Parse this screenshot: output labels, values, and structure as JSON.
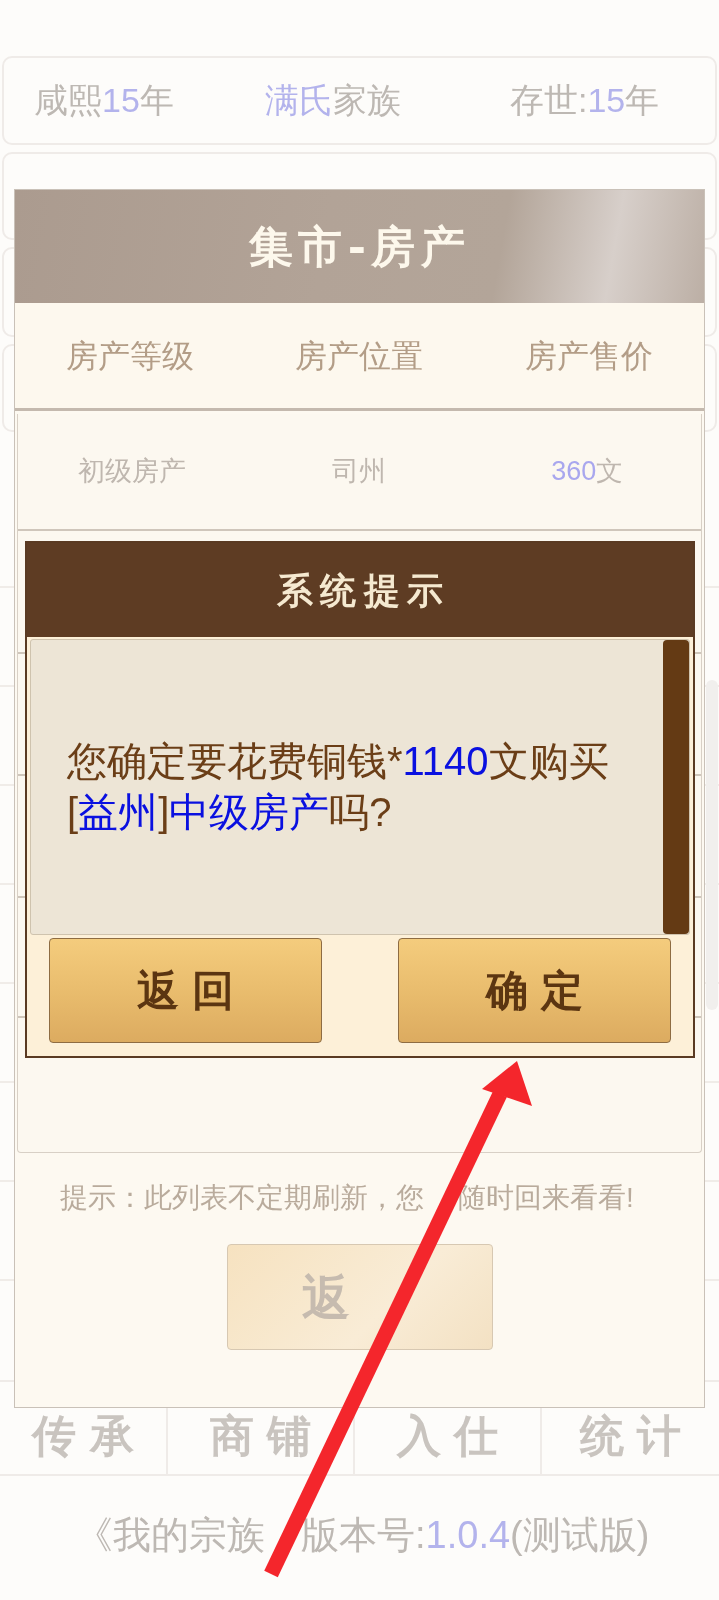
{
  "background": {
    "info_row": [
      [
        {
          "text": "咸熙",
          "highlight": false
        },
        {
          "text": "15",
          "highlight": true
        },
        {
          "text": "年",
          "highlight": false
        }
      ],
      [
        {
          "text": "满氏",
          "highlight": true
        },
        {
          "text": "家族",
          "highlight": false
        }
      ],
      [
        {
          "text": "存世:",
          "highlight": false
        },
        {
          "text": "15",
          "highlight": true
        },
        {
          "text": "年",
          "highlight": false
        }
      ]
    ],
    "nav_tabs": [
      "传承",
      "商铺",
      "入仕",
      "统计"
    ],
    "footer": [
      [
        {
          "text": "《我的宗族",
          "highlight": false
        }
      ],
      [
        {
          "text": "版本号:",
          "highlight": false
        },
        {
          "text": "1.0.4",
          "highlight": true
        },
        {
          "text": "(测试版)",
          "highlight": false
        }
      ]
    ]
  },
  "market_panel": {
    "title": "集市-房产",
    "columns": [
      "房产等级",
      "房产位置",
      "房产售价"
    ],
    "rows": [
      [
        [
          {
            "text": "初级房产",
            "highlight": false
          }
        ],
        [
          {
            "text": "司州",
            "highlight": false
          }
        ],
        [
          {
            "text": "360",
            "highlight": true
          },
          {
            "text": "文",
            "highlight": false
          }
        ]
      ]
    ],
    "hint": [
      "提示：此列表不定期刷新，您",
      "随时回来看看!"
    ],
    "back_button": "返"
  },
  "dialog": {
    "title": "系统提示",
    "message": [
      {
        "text": "您确定要花费铜钱*",
        "highlight": false
      },
      {
        "text": "1140",
        "highlight": true
      },
      {
        "text": "文购买[",
        "highlight": false
      },
      {
        "text": "益州",
        "highlight": true
      },
      {
        "text": "]",
        "highlight": false
      },
      {
        "text": "中级房产",
        "highlight": true
      },
      {
        "text": "吗?",
        "highlight": false
      }
    ],
    "buttons": [
      "返回",
      "确定"
    ]
  }
}
